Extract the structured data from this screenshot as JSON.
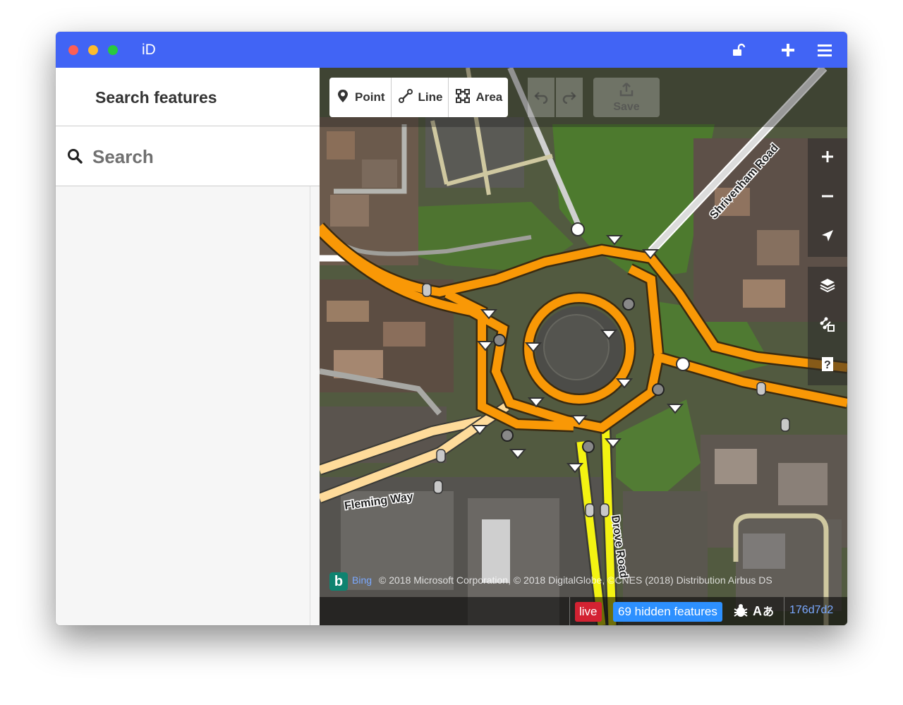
{
  "window": {
    "title": "iD"
  },
  "titlebar": {
    "lock_icon": "unlock-icon",
    "add_icon": "plus-icon",
    "menu_icon": "hamburger-menu-icon"
  },
  "sidebar": {
    "header_title": "Search features",
    "search_placeholder": "Search"
  },
  "toolbar": {
    "modes": [
      {
        "label": "Point",
        "icon": "point-icon"
      },
      {
        "label": "Line",
        "icon": "line-icon"
      },
      {
        "label": "Area",
        "icon": "area-icon"
      }
    ],
    "undo_icon": "undo-icon",
    "redo_icon": "redo-icon",
    "save_label": "Save"
  },
  "map_controls": [
    "zoom-in-icon",
    "zoom-out-icon",
    "geolocate-icon",
    "layers-icon",
    "map-data-icon",
    "help-icon"
  ],
  "road_labels": {
    "shrivenham": "Shrivenham Road",
    "fleming": "Fleming Way",
    "drove": "Drove Road"
  },
  "attribution": {
    "imagery_logo": "b",
    "imagery_name": "Bing",
    "copyright": "© 2018 Microsoft Corporation, © 2018 DigitalGlobe, ©CNES (2018) Distribution Airbus DS"
  },
  "footer": {
    "live_label": "live",
    "hidden_features": "69 hidden features",
    "issues_icon": "bug-icon",
    "translate_icon": "translate-icon",
    "version": "176d7d2"
  },
  "colors": {
    "titlebar": "#4164f5",
    "primary_road": "#f99806",
    "trunk_road": "#f3f312",
    "secondary_road": "#fedb9a",
    "live_badge": "#d32232",
    "hidden_badge": "#2d90ff"
  }
}
